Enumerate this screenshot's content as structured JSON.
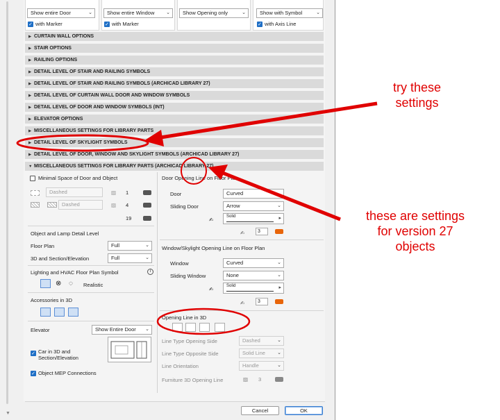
{
  "top_cards": [
    {
      "dropdown": "Show entire Door",
      "check": "with Marker",
      "checked": true
    },
    {
      "dropdown": "Show entire Window",
      "check": "with Marker",
      "checked": true
    },
    {
      "dropdown": "Show Opening only",
      "check": "",
      "checked": false
    },
    {
      "dropdown": "Show with Symbol",
      "check": "with Axis Line",
      "checked": true
    }
  ],
  "sections": [
    "CURTAIN WALL OPTIONS",
    "STAIR OPTIONS",
    "RAILING OPTIONS",
    "DETAIL LEVEL OF STAIR AND RAILING SYMBOLS",
    "DETAIL LEVEL OF STAIR AND RAILING SYMBOLS (ARCHICAD LIBRARY 27)",
    "DETAIL LEVEL OF CURTAIN WALL DOOR AND WINDOW SYMBOLS",
    "DETAIL LEVEL OF DOOR AND WINDOW SYMBOLS (INT)",
    "ELEVATOR OPTIONS",
    "MISCELLANEOUS SETTINGS FOR LIBRARY PARTS",
    "DETAIL LEVEL OF SKYLIGHT SYMBOLS",
    "DETAIL LEVEL OF DOOR, WINDOW AND SKYLIGHT SYMBOLS (ARCHICAD LIBRARY 27)"
  ],
  "expanded_section": "MISCELLANEOUS SETTINGS FOR LIBRARY PARTS (ARCHICAD LIBRARY 27)",
  "left": {
    "minimal_space": "Minimal Space of Door and Object",
    "line_dashed": "Dashed",
    "fill_dashed": "Dashed",
    "pen_1": "1",
    "pen_4": "4",
    "pen_19": "19",
    "object_lamp_title": "Object and Lamp Detail Level",
    "floor_plan_label": "Floor Plan",
    "floor_plan_value": "Full",
    "section_label": "3D and Section/Elevation",
    "section_value": "Full",
    "lighting_title": "Lighting and HVAC Floor Plan Symbol",
    "realistic": "Realistic",
    "info_icon": "info-icon",
    "accessories_title": "Accessories in 3D",
    "elevator_label": "Elevator",
    "elevator_value": "Show Entire Door",
    "car_label_1": "Car in 3D and",
    "car_label_2": "Section/Elevation",
    "mep_label": "Object MEP Connections"
  },
  "right": {
    "door_opening_title": "Door Opening Line on Floor Plan",
    "door_label": "Door",
    "door_value": "Curved",
    "sliding_door_label": "Sliding Door",
    "sliding_door_value": "Arrow",
    "solid_1": "Solid",
    "pen_door": "3",
    "window_title": "Window/Skylight Opening Line on Floor Plan",
    "window_label": "Window",
    "window_value": "Curved",
    "sliding_window_label": "Sliding Window",
    "sliding_window_value": "None",
    "solid_2": "Solid",
    "pen_window": "3",
    "opening3d_title": "Opening Line in 3D",
    "lt_opening_label": "Line Type Opening Side",
    "lt_opening_value": "Dashed",
    "lt_opposite_label": "Line Type Opposite Side",
    "lt_opposite_value": "Solid Line",
    "orientation_label": "Line Orientation",
    "orientation_value": "Handle",
    "furniture_label": "Furniture 3D Opening Line",
    "furniture_pen": "3"
  },
  "buttons": {
    "cancel": "Cancel",
    "ok": "OK"
  },
  "annotations": {
    "try_1": "try these",
    "try_2": "settings",
    "these_1": "these are settings",
    "these_2": "for version 27",
    "these_3": "objects"
  },
  "colors": {
    "annotation": "#e00000",
    "checkbox": "#1f6fc6",
    "pen_orange": "#e8650a"
  }
}
